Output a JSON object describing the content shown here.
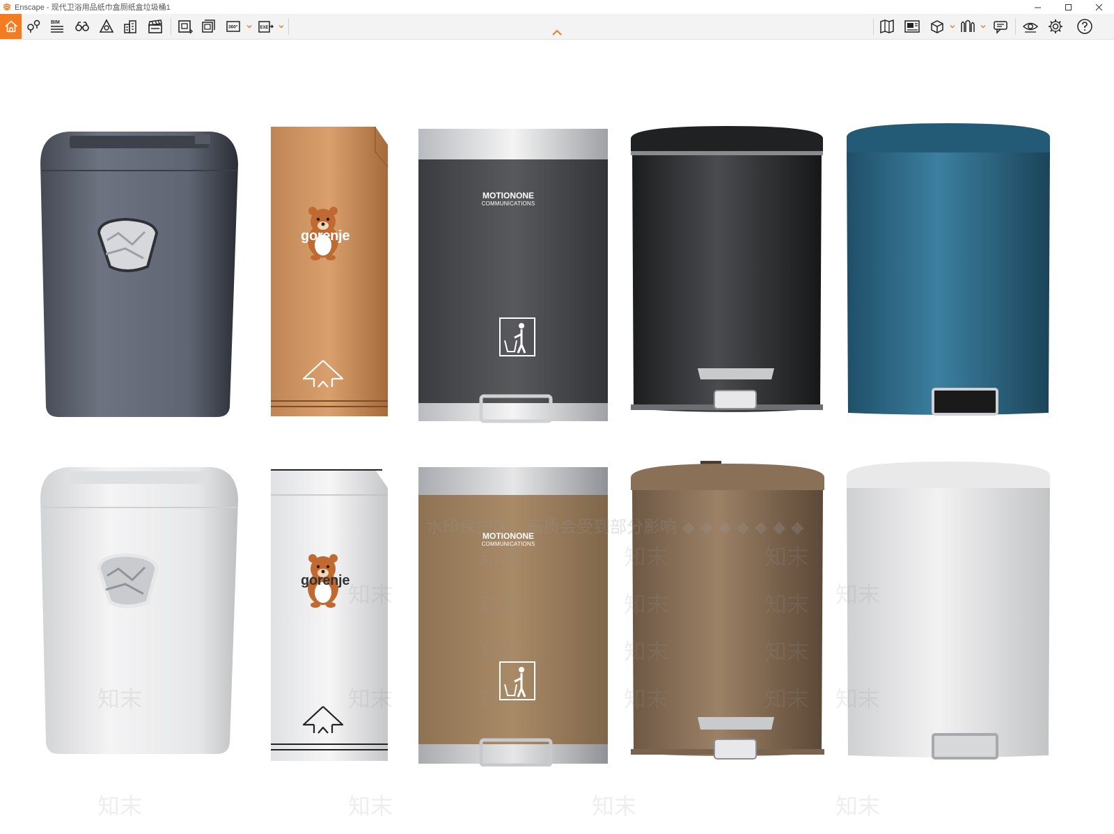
{
  "window": {
    "title": "Enscape - 现代卫浴用品纸巾盒厕纸盒垃圾桶1"
  },
  "toolbar": {
    "icons": [
      "home-icon",
      "pin-icon",
      "bim-icon",
      "binoculars-icon",
      "asset-library-icon",
      "buildings-icon",
      "clapper-icon",
      "screenshot-icon",
      "batch-render-icon",
      "panorama-360-icon",
      "export-exe-icon",
      "map-icon",
      "views-icon",
      "cube-icon",
      "atmosphere-icon",
      "feedback-icon",
      "visual-settings-icon",
      "settings-icon",
      "help-icon"
    ],
    "bim_label": "BIM",
    "pano_label": "360°",
    "exe_label": "EXE",
    "accent_color": "#f47b20"
  },
  "products": {
    "gorenje_label": "gorenje",
    "motionone_title": "MOTIONONE",
    "motionone_sub": "COMMUNICATIONS"
  },
  "watermark": {
    "banner": "水印保护区，画质会受到部分影响 ◆ ◆ ◆ ◆ ◆ ◆ ◆",
    "mark": "知末"
  }
}
